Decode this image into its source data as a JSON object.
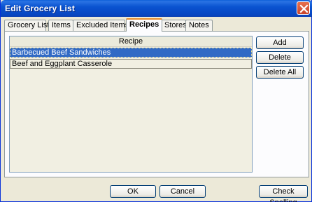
{
  "window": {
    "title": "Edit Grocery List"
  },
  "tabs": [
    {
      "label": "Grocery List"
    },
    {
      "label": "Items"
    },
    {
      "label": "Excluded Items"
    },
    {
      "label": "Recipes"
    },
    {
      "label": "Stores"
    },
    {
      "label": "Notes"
    }
  ],
  "active_tab": "Recipes",
  "recipes_list": {
    "column_header": "Recipe",
    "rows": [
      {
        "name": "Barbecued Beef Sandwiches",
        "selected": true
      },
      {
        "name": "Beef and Eggplant Casserole",
        "selected": false
      }
    ]
  },
  "side_buttons": {
    "add": "Add",
    "delete": "Delete",
    "delete_all": "Delete All"
  },
  "footer_buttons": {
    "ok": "OK",
    "cancel": "Cancel",
    "check_spelling": "Check Spelling"
  },
  "colors": {
    "title_bar": "#0a53d0",
    "selection": "#316ac5",
    "close_button": "#c9432a",
    "active_tab_accent": "#e68b2c"
  }
}
